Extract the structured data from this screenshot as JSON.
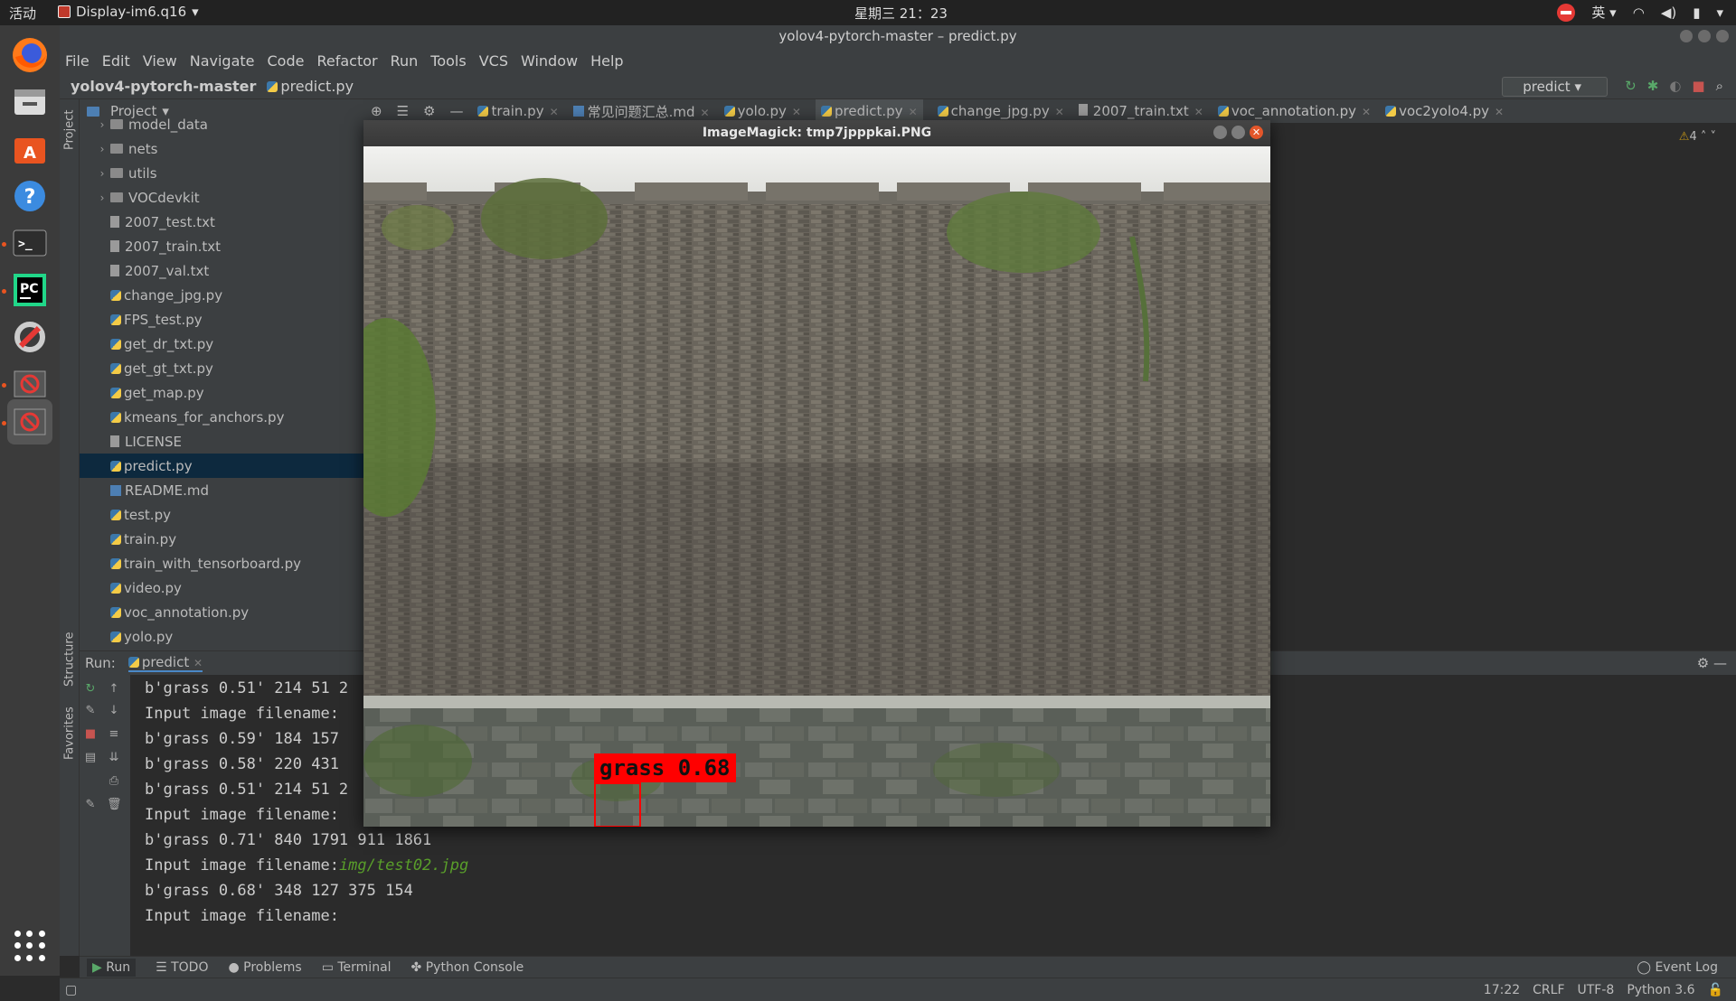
{
  "topbar": {
    "activities": "活动",
    "app_menu": "Display-im6.q16",
    "clock": "星期三 21：23",
    "ime": "英"
  },
  "ide": {
    "title": "yolov4-pytorch-master – predict.py",
    "menu": [
      "File",
      "Edit",
      "View",
      "Navigate",
      "Code",
      "Refactor",
      "Run",
      "Tools",
      "VCS",
      "Window",
      "Help"
    ],
    "breadcrumb": {
      "project": "yolov4-pytorch-master",
      "file": "predict.py"
    },
    "run_config": "predict"
  },
  "project_panel": {
    "title": "Project",
    "side_tab": "Project",
    "items": [
      {
        "label": "model_data",
        "type": "folder"
      },
      {
        "label": "nets",
        "type": "folder"
      },
      {
        "label": "utils",
        "type": "folder"
      },
      {
        "label": "VOCdevkit",
        "type": "folder"
      },
      {
        "label": "2007_test.txt",
        "type": "file"
      },
      {
        "label": "2007_train.txt",
        "type": "file"
      },
      {
        "label": "2007_val.txt",
        "type": "file"
      },
      {
        "label": "change_jpg.py",
        "type": "py"
      },
      {
        "label": "FPS_test.py",
        "type": "py"
      },
      {
        "label": "get_dr_txt.py",
        "type": "py"
      },
      {
        "label": "get_gt_txt.py",
        "type": "py"
      },
      {
        "label": "get_map.py",
        "type": "py"
      },
      {
        "label": "kmeans_for_anchors.py",
        "type": "py"
      },
      {
        "label": "LICENSE",
        "type": "file"
      },
      {
        "label": "predict.py",
        "type": "py"
      },
      {
        "label": "README.md",
        "type": "md"
      },
      {
        "label": "test.py",
        "type": "py"
      },
      {
        "label": "train.py",
        "type": "py"
      },
      {
        "label": "train_with_tensorboard.py",
        "type": "py"
      },
      {
        "label": "video.py",
        "type": "py"
      },
      {
        "label": "voc_annotation.py",
        "type": "py"
      },
      {
        "label": "yolo.py",
        "type": "py"
      }
    ]
  },
  "editor_tabs": [
    "train.py",
    "常见问题汇总.md",
    "yolo.py",
    "predict.py",
    "change_jpg.py",
    "2007_train.txt",
    "voc_annotation.py",
    "voc2yolo4.py"
  ],
  "editor": {
    "warnings": "4"
  },
  "run_panel": {
    "label": "Run:",
    "tab": "predict",
    "lines": [
      {
        "text": "b'grass 0.51' 214 51 2"
      },
      {
        "text": "Input image filename:"
      },
      {
        "text": "b'grass 0.59' 184 157"
      },
      {
        "text": "b'grass 0.58' 220 431"
      },
      {
        "text": "b'grass 0.51' 214 51 2"
      },
      {
        "text": "Input image filename:"
      },
      {
        "text": "b'grass 0.71' 840 1791 911 1861"
      },
      {
        "text": "Input image filename:",
        "path": "img/test02.jpg"
      },
      {
        "text": "b'grass 0.68' 348 127 375 154"
      },
      {
        "text": "Input image filename:"
      }
    ]
  },
  "side_tabs": {
    "structure": "Structure",
    "favorites": "Favorites"
  },
  "bottom_tools": [
    "Run",
    "TODO",
    "Problems",
    "Terminal",
    "Python Console"
  ],
  "event_log": "Event Log",
  "status": {
    "position": "17:22",
    "line_sep": "CRLF",
    "encoding": "UTF-8",
    "interpreter": "Python 3.6"
  },
  "imagemagick": {
    "title": "ImageMagick: tmp7jpppkai.PNG",
    "detection_label": "grass 0.68"
  },
  "colors": {
    "selection": "#0d293e",
    "detection": "#ff0000",
    "path_green": "#599e2a"
  }
}
